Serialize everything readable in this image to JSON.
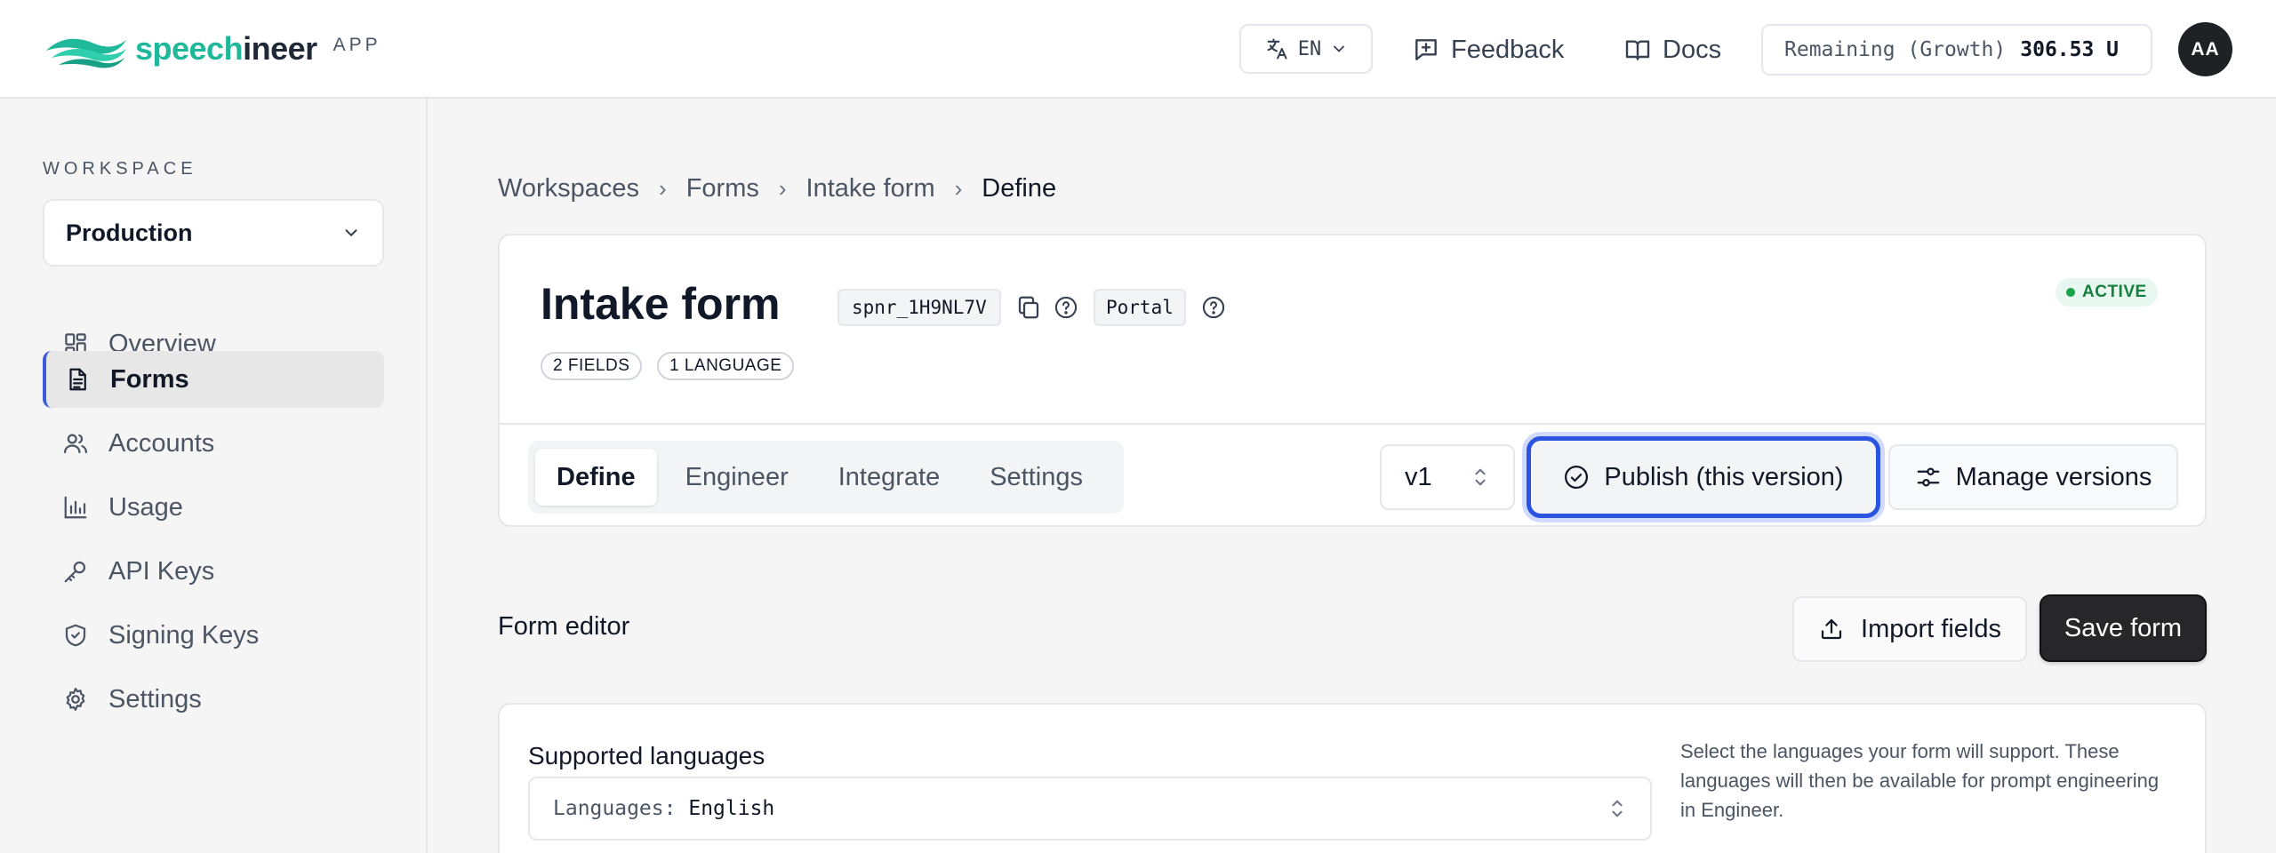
{
  "header": {
    "brand_part1": "speech",
    "brand_part2": "ineer",
    "brand_suffix": "APP",
    "language": "EN",
    "feedback_label": "Feedback",
    "docs_label": "Docs",
    "remaining_label": "Remaining (Growth)",
    "remaining_value": "306.53 U",
    "avatar_initials": "AA"
  },
  "sidebar": {
    "workspace_label": "WORKSPACE",
    "workspace_selected": "Production",
    "items": [
      {
        "label": "Overview",
        "icon": "grid-icon"
      },
      {
        "label": "Forms",
        "icon": "document-icon",
        "active": true
      },
      {
        "label": "Accounts",
        "icon": "users-icon"
      },
      {
        "label": "Usage",
        "icon": "bar-chart-icon"
      },
      {
        "label": "API Keys",
        "icon": "key-icon"
      },
      {
        "label": "Signing Keys",
        "icon": "shield-icon"
      },
      {
        "label": "Settings",
        "icon": "gear-icon"
      }
    ]
  },
  "breadcrumb": {
    "items": [
      "Workspaces",
      "Forms",
      "Intake form",
      "Define"
    ]
  },
  "form": {
    "title": "Intake form",
    "id_code": "spnr_1H9NL7V",
    "channel": "Portal",
    "fields_count": "2 FIELDS",
    "languages_count": "1 LANGUAGE",
    "status": "ACTIVE",
    "tabs": [
      "Define",
      "Engineer",
      "Integrate",
      "Settings"
    ],
    "version": "v1",
    "publish_label": "Publish (this version)",
    "manage_label": "Manage versions"
  },
  "editor": {
    "title": "Form editor",
    "import_label": "Import fields",
    "save_label": "Save form",
    "languages_label": "Supported languages",
    "languages_prefix": "Languages:",
    "languages_value": "English",
    "help_text": "Select the languages your form will support. These languages will then be available for prompt engineering in Engineer."
  },
  "colors": {
    "accent": "#2b54e0",
    "brand": "#1fb89a",
    "status_active": "#16a34a"
  }
}
